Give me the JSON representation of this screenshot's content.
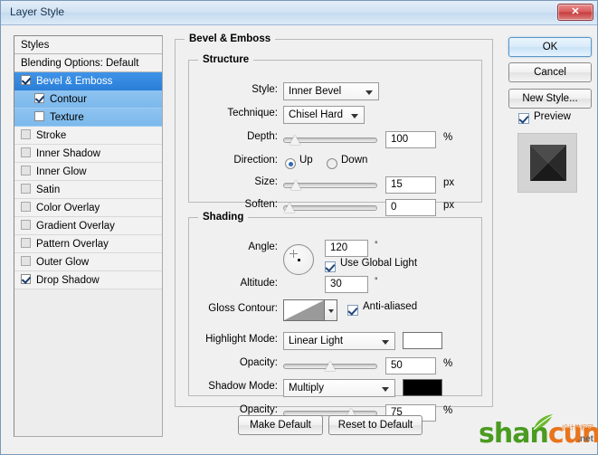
{
  "window": {
    "title": "Layer Style",
    "close_label": "✕"
  },
  "styles_panel": {
    "header": "Styles",
    "blending_options": "Blending Options: Default",
    "items": [
      {
        "label": "Bevel & Emboss",
        "checked": true,
        "selected": true,
        "sub": false
      },
      {
        "label": "Contour",
        "checked": true,
        "selected": false,
        "sub": true
      },
      {
        "label": "Texture",
        "checked": false,
        "selected": false,
        "sub": true
      },
      {
        "label": "Stroke",
        "checked": false,
        "selected": false,
        "sub": false
      },
      {
        "label": "Inner Shadow",
        "checked": false,
        "selected": false,
        "sub": false
      },
      {
        "label": "Inner Glow",
        "checked": false,
        "selected": false,
        "sub": false
      },
      {
        "label": "Satin",
        "checked": false,
        "selected": false,
        "sub": false
      },
      {
        "label": "Color Overlay",
        "checked": false,
        "selected": false,
        "sub": false
      },
      {
        "label": "Gradient Overlay",
        "checked": false,
        "selected": false,
        "sub": false
      },
      {
        "label": "Pattern Overlay",
        "checked": false,
        "selected": false,
        "sub": false
      },
      {
        "label": "Outer Glow",
        "checked": false,
        "selected": false,
        "sub": false
      },
      {
        "label": "Drop Shadow",
        "checked": true,
        "selected": false,
        "sub": false
      }
    ]
  },
  "panel": {
    "title": "Bevel & Emboss",
    "structure": {
      "legend": "Structure",
      "style_label": "Style:",
      "style_value": "Inner Bevel",
      "technique_label": "Technique:",
      "technique_value": "Chisel Hard",
      "depth_label": "Depth:",
      "depth_value": "100",
      "depth_unit": "%",
      "depth_percent": 8,
      "direction_label": "Direction:",
      "direction_up": "Up",
      "direction_down": "Down",
      "direction_selected": "Up",
      "size_label": "Size:",
      "size_value": "15",
      "size_unit": "px",
      "size_percent": 9,
      "soften_label": "Soften:",
      "soften_value": "0",
      "soften_unit": "px",
      "soften_percent": 1
    },
    "shading": {
      "legend": "Shading",
      "angle_label": "Angle:",
      "angle_value": "120",
      "angle_unit": "°",
      "use_global_light": "Use Global Light",
      "use_global_light_checked": true,
      "altitude_label": "Altitude:",
      "altitude_value": "30",
      "altitude_unit": "°",
      "gloss_contour_label": "Gloss Contour:",
      "anti_aliased": "Anti-aliased",
      "anti_aliased_checked": true,
      "highlight_mode_label": "Highlight Mode:",
      "highlight_mode_value": "Linear Light",
      "highlight_color": "#ffffff",
      "highlight_opacity_label": "Opacity:",
      "highlight_opacity_value": "50",
      "highlight_opacity_unit": "%",
      "highlight_opacity_percent": 50,
      "shadow_mode_label": "Shadow Mode:",
      "shadow_mode_value": "Multiply",
      "shadow_color": "#000000",
      "shadow_opacity_label": "Opacity:",
      "shadow_opacity_value": "75",
      "shadow_opacity_unit": "%",
      "shadow_opacity_percent": 75
    }
  },
  "buttons": {
    "ok": "OK",
    "cancel": "Cancel",
    "new_style": "New Style...",
    "preview": "Preview",
    "preview_checked": true,
    "make_default": "Make Default",
    "reset_to_default": "Reset to Default"
  },
  "watermark": {
    "shan": "shan",
    "cun": "cun",
    "net": ".net",
    "cn": "设计教程网"
  }
}
